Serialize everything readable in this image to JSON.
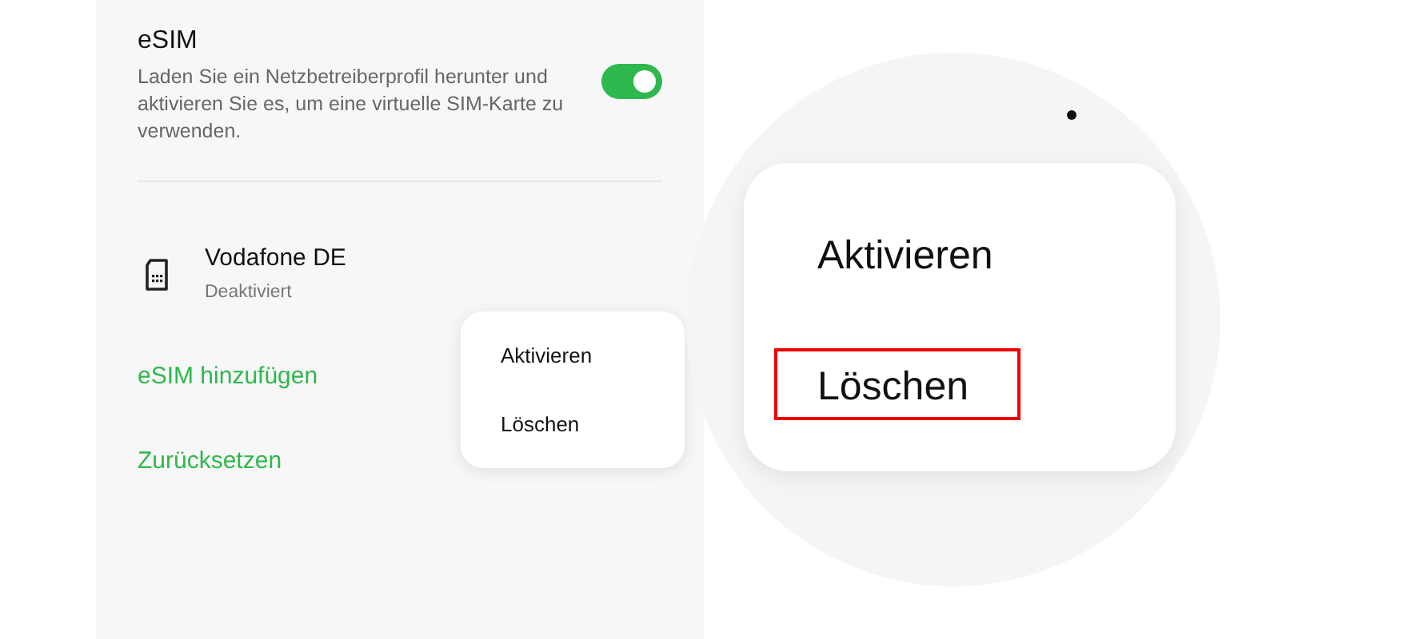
{
  "esim": {
    "title": "eSIM",
    "description": "Laden Sie ein Netzbetreiberprofil herunter und aktivieren Sie es, um eine virtuelle SIM-Karte zu verwenden.",
    "on": true
  },
  "profile": {
    "name": "Vodafone DE",
    "status": "Deaktiviert"
  },
  "actions": [
    "eSIM hinzufügen",
    "Zurücksetzen"
  ],
  "menu": {
    "items": [
      {
        "label": "Aktivieren",
        "highlighted": false
      },
      {
        "label": "Löschen",
        "highlighted": false
      }
    ]
  },
  "magnifier": {
    "items": [
      {
        "label": "Aktivieren",
        "highlighted": false
      },
      {
        "label": "Löschen",
        "highlighted": true
      }
    ]
  }
}
